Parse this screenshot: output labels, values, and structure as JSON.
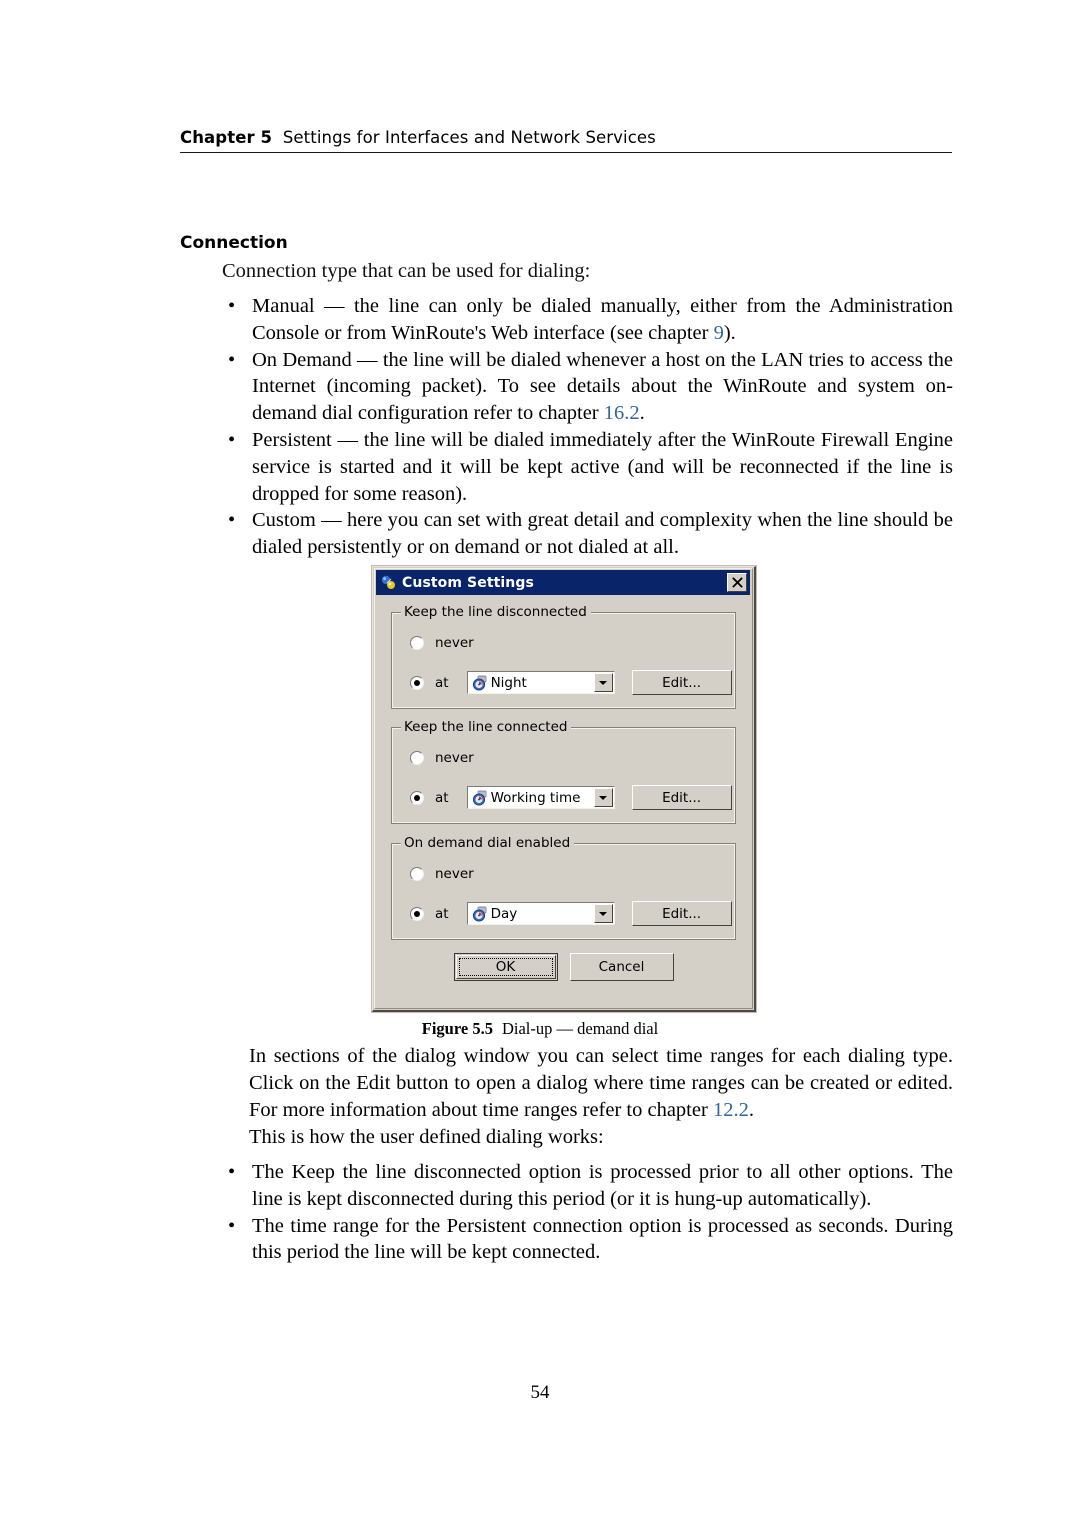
{
  "header": {
    "chapter_label": "Chapter 5",
    "title": "Settings for Interfaces and Network Services"
  },
  "section": {
    "heading": "Connection",
    "intro": "Connection type that can be used for dialing:"
  },
  "bullets_top": [
    {
      "marker": "•",
      "term": "Manual",
      "parts": [
        {
          "text": "Manual",
          "style": "italic"
        },
        {
          "text": " — the line can only be dialed manually, either from the ",
          "style": "normal"
        },
        {
          "text": "Administration Console",
          "style": "italic"
        },
        {
          "text": " or from ",
          "style": "normal"
        },
        {
          "text": "WinRoute's",
          "style": "italic"
        },
        {
          "text": " Web interface (see chapter ",
          "style": "normal"
        },
        {
          "text": "9",
          "style": "xref"
        },
        {
          "text": ").",
          "style": "normal"
        }
      ]
    },
    {
      "marker": "•",
      "term": "On Demand",
      "parts": [
        {
          "text": "On Demand",
          "style": "italic"
        },
        {
          "text": " — the line will be dialed whenever a host on the LAN tries to access the Internet (incoming packet).  To see details about the ",
          "style": "normal"
        },
        {
          "text": "WinRoute",
          "style": "italic"
        },
        {
          "text": " and system on-demand dial configuration refer to chapter ",
          "style": "normal"
        },
        {
          "text": "16.2",
          "style": "xref"
        },
        {
          "text": ".",
          "style": "normal"
        }
      ]
    },
    {
      "marker": "•",
      "term": "Persistent",
      "parts": [
        {
          "text": "Persistent",
          "style": "italic"
        },
        {
          "text": " — the line will be dialed immediately after the ",
          "style": "normal"
        },
        {
          "text": "WinRoute Firewall Engine",
          "style": "italic"
        },
        {
          "text": " service is started and it will be kept active (and will be reconnected if the line is dropped for some reason).",
          "style": "normal"
        }
      ]
    },
    {
      "marker": "•",
      "term": "Custom",
      "parts": [
        {
          "text": "Custom",
          "style": "italic"
        },
        {
          "text": " — here you can set with great detail and complexity when the line should be dialed persistently or on demand or not dialed at all.",
          "style": "normal"
        }
      ]
    }
  ],
  "dialog": {
    "title": "Custom Settings",
    "title_icon": "network-settings-icon",
    "close_label": "✕",
    "groups": [
      {
        "legend": "Keep the line disconnected",
        "never_label": "never",
        "never_selected": false,
        "at_label": "at",
        "at_selected": true,
        "combo_value": "Night",
        "combo_icon": "time-range-clock-icon",
        "edit_label": "Edit..."
      },
      {
        "legend": "Keep the line connected",
        "never_label": "never",
        "never_selected": false,
        "at_label": "at",
        "at_selected": true,
        "combo_value": "Working time",
        "combo_icon": "time-range-clock-icon",
        "edit_label": "Edit..."
      },
      {
        "legend": "On demand dial enabled",
        "never_label": "never",
        "never_selected": false,
        "at_label": "at",
        "at_selected": true,
        "combo_value": "Day",
        "combo_icon": "time-range-clock-icon",
        "edit_label": "Edit..."
      }
    ],
    "ok_label": "OK",
    "cancel_label": "Cancel",
    "colors": {
      "titlebar": "#0a246a",
      "face": "#d4d0c8",
      "field": "#ffffff"
    }
  },
  "figure": {
    "number": "Figure 5.5",
    "caption": "Dial-up — demand dial"
  },
  "after_figure": {
    "parts": [
      {
        "text": "In sections of the dialog window you can select time ranges for each dialing type. Click on the ",
        "style": "normal"
      },
      {
        "text": "Edit",
        "style": "italic"
      },
      {
        "text": " button to open a dialog where time ranges can be created or edited. For more information about time ranges refer to chapter ",
        "style": "normal"
      },
      {
        "text": "12.2",
        "style": "xref"
      },
      {
        "text": ".",
        "style": "normal"
      }
    ],
    "last_line": "This is how the user defined dialing works:"
  },
  "bullets_bottom": [
    {
      "marker": "•",
      "parts": [
        {
          "text": "The ",
          "style": "normal"
        },
        {
          "text": "Keep the line disconnected",
          "style": "italic"
        },
        {
          "text": " option is processed prior to all other options. The line is kept disconnected during this period (or it is hung-up automatically).",
          "style": "normal"
        }
      ]
    },
    {
      "marker": "•",
      "parts": [
        {
          "text": "The time range for the ",
          "style": "normal"
        },
        {
          "text": "Persistent connection",
          "style": "italic"
        },
        {
          "text": " option is processed as seconds. During this period the line will be kept connected.",
          "style": "normal"
        }
      ]
    }
  ],
  "page_number": "54"
}
